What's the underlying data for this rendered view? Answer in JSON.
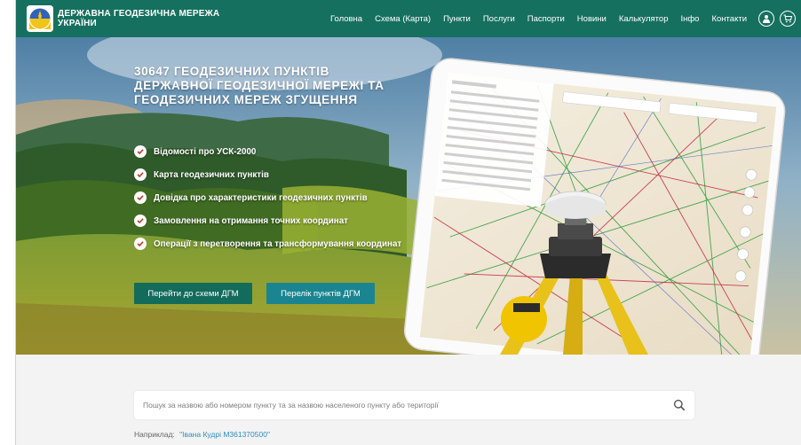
{
  "header": {
    "brand_line1": "ДЕРЖАВНА ГЕОДЕЗИЧНА МЕРЕЖА",
    "brand_line2": "УКРАЇНИ",
    "nav": [
      "Головна",
      "Схема (Карта)",
      "Пункти",
      "Послуги",
      "Паспорти",
      "Новини",
      "Калькулятор",
      "Інфо",
      "Контакти"
    ]
  },
  "hero": {
    "title_lines": [
      "30647 ГЕОДЕЗИЧНИХ ПУНКТІВ",
      "ДЕРЖАВНОЇ ГЕОДЕЗИЧНОЇ МЕРЕЖІ ТА",
      "ГЕОДЕЗИЧНИХ МЕРЕЖ ЗГУЩЕННЯ"
    ],
    "features": [
      "Відомості про УСК-2000",
      "Карта геодезичних пунктів",
      "Довідка про характеристики геодезичних пунктів",
      "Замовлення на отримання точних координат",
      "Операції з перетворення та трансформування координат"
    ],
    "btn_scheme": "Перейти до схеми ДГМ",
    "btn_list": "Перелік пунктів ДГМ"
  },
  "search": {
    "placeholder": "Пошук за назвою або номером пункту та за назвою населеного пункту або території",
    "example_label": "Наприклад:",
    "example_value": "\"Івана Кудрі М361370500\""
  },
  "colors": {
    "header_bg": "#16705f",
    "btn_scheme": "#136b5c",
    "btn_list": "#1a8590",
    "link": "#2d8fbf"
  }
}
